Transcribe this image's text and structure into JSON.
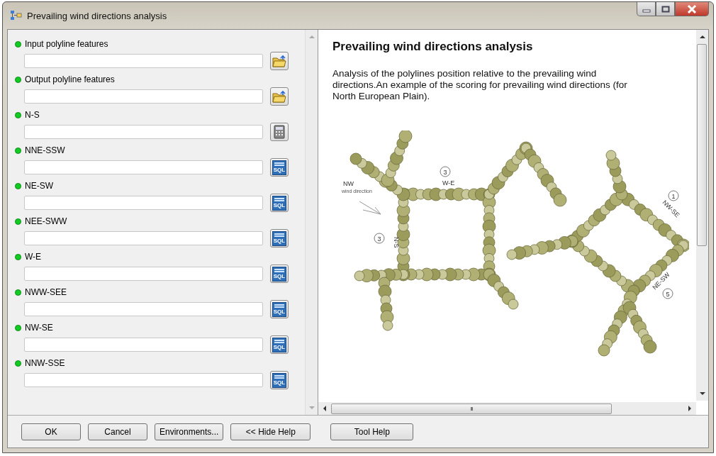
{
  "window": {
    "title": "Prevailing wind directions analysis"
  },
  "parameters": [
    {
      "label": "Input polyline features",
      "required": true,
      "button": {
        "kind": "folder"
      }
    },
    {
      "label": "Output polyline features",
      "required": true,
      "button": {
        "kind": "folder"
      }
    },
    {
      "label": "N-S",
      "required": true,
      "button": {
        "kind": "calculator"
      }
    },
    {
      "label": "NNE-SSW",
      "required": true,
      "button": {
        "kind": "sql",
        "text": "SQL"
      }
    },
    {
      "label": "NE-SW",
      "required": true,
      "button": {
        "kind": "sql",
        "text": "SQL"
      }
    },
    {
      "label": "NEE-SWW",
      "required": true,
      "button": {
        "kind": "sql",
        "text": "SQL"
      }
    },
    {
      "label": "W-E",
      "required": true,
      "button": {
        "kind": "sql",
        "text": "SQL"
      }
    },
    {
      "label": "NWW-SEE",
      "required": true,
      "button": {
        "kind": "sql",
        "text": "SQL"
      }
    },
    {
      "label": "NW-SE",
      "required": true,
      "button": {
        "kind": "sql",
        "text": "SQL"
      }
    },
    {
      "label": "NNW-SSE",
      "required": true,
      "button": {
        "kind": "sql",
        "text": "SQL"
      }
    }
  ],
  "help": {
    "title": "Prevailing wind directions analysis",
    "text": "Analysis of the polylines position relative to the prevailing wind directions.An example of the scoring for prevailing wind directions (for North European Plain).",
    "figure_labels": [
      {
        "kind": "plain",
        "text": "NW"
      },
      {
        "kind": "small",
        "text": "wind direction"
      },
      {
        "kind": "circled",
        "text": "3"
      },
      {
        "kind": "plain",
        "text": "W-E"
      },
      {
        "kind": "circled",
        "text": "3"
      },
      {
        "kind": "plain",
        "text": "N-S"
      },
      {
        "kind": "circled",
        "text": "1"
      },
      {
        "kind": "plain",
        "text": "NW-SE"
      },
      {
        "kind": "plain",
        "text": "NE-SW"
      },
      {
        "kind": "circled",
        "text": "5"
      }
    ],
    "hscroll_grip": "III"
  },
  "buttons": [
    "OK",
    "Cancel",
    "Environments...",
    "<< Hide Help"
  ],
  "help_button": "Tool Help"
}
